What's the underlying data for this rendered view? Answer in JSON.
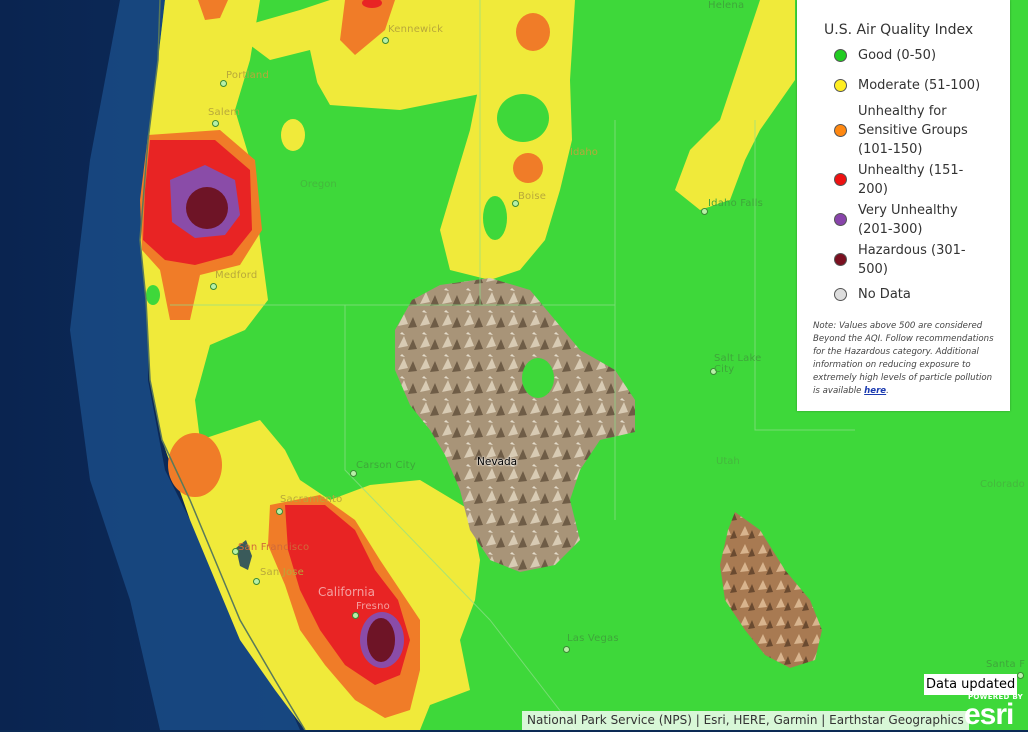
{
  "map": {
    "cities": [
      {
        "name": "Helena"
      },
      {
        "name": "Kennewick"
      },
      {
        "name": "Portland"
      },
      {
        "name": "Salem"
      },
      {
        "name": "Boise"
      },
      {
        "name": "Idaho Falls"
      },
      {
        "name": "Medford"
      },
      {
        "name": "Salt Lake City"
      },
      {
        "name": "Carson City"
      },
      {
        "name": "Sacramento"
      },
      {
        "name": "San Francisco"
      },
      {
        "name": "San Jose"
      },
      {
        "name": "Fresno"
      },
      {
        "name": "Las Vegas"
      },
      {
        "name": "Santa F"
      }
    ],
    "states": [
      {
        "name": "Oregon"
      },
      {
        "name": "Idaho"
      },
      {
        "name": "Nevada"
      },
      {
        "name": "Utah"
      },
      {
        "name": "Colorado"
      },
      {
        "name": "California"
      }
    ]
  },
  "legend": {
    "title": "U.S. Air Quality Index",
    "items": [
      {
        "label": "Good (0-50)",
        "color": "#22cc22"
      },
      {
        "label": "Moderate (51-100)",
        "color": "#ffee22"
      },
      {
        "label": "Unhealthy for Sensitive Groups (101-150)",
        "color": "#ff8811"
      },
      {
        "label": "Unhealthy (151-200)",
        "color": "#ee1111"
      },
      {
        "label": "Very Unhealthy (201-300)",
        "color": "#8844aa"
      },
      {
        "label": "Hazardous (301-500)",
        "color": "#7a1020"
      },
      {
        "label": "No Data",
        "color": "#dddddd"
      }
    ],
    "note_text": "Note: Values above 500 are considered Beyond the AQI. Follow recommendations for the Hazardous category. Additional information on reducing exposure to extremely high levels of particle pollution is available ",
    "note_link": "here",
    "note_end": "."
  },
  "status": {
    "data_updated": "Data updated"
  },
  "attribution": {
    "text": "National Park Service (NPS) | Esri, HERE, Garmin | Earthstar Geographics"
  },
  "esri": {
    "powered_by": "POWERED BY",
    "logo": "esri"
  },
  "colors": {
    "good": "#3ed83a",
    "moderate": "#f0ea3a",
    "usg": "#f07c28",
    "unhealthy": "#e82424",
    "very_unhealthy": "#8a4ca8",
    "hazardous": "#6e1426",
    "ocean": "#0f3468"
  }
}
